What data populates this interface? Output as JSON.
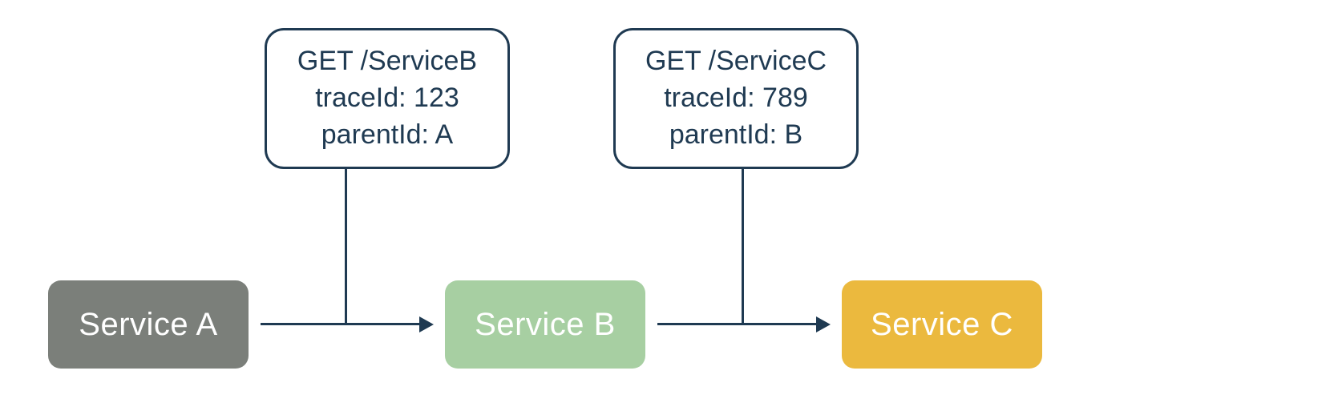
{
  "services": {
    "a": {
      "label": "Service A",
      "color": "#7b7f7a"
    },
    "b": {
      "label": "Service B",
      "color": "#a7cfa2"
    },
    "c": {
      "label": "Service C",
      "color": "#ebb93e"
    }
  },
  "calls": {
    "ab": {
      "request_line": "GET /ServiceB",
      "trace_line": "traceId: 123",
      "parent_line": "parentId: A"
    },
    "bc": {
      "request_line": "GET /ServiceC",
      "trace_line": "traceId: 789",
      "parent_line": "parentId: B"
    }
  },
  "colors": {
    "stroke": "#1f3a52"
  }
}
